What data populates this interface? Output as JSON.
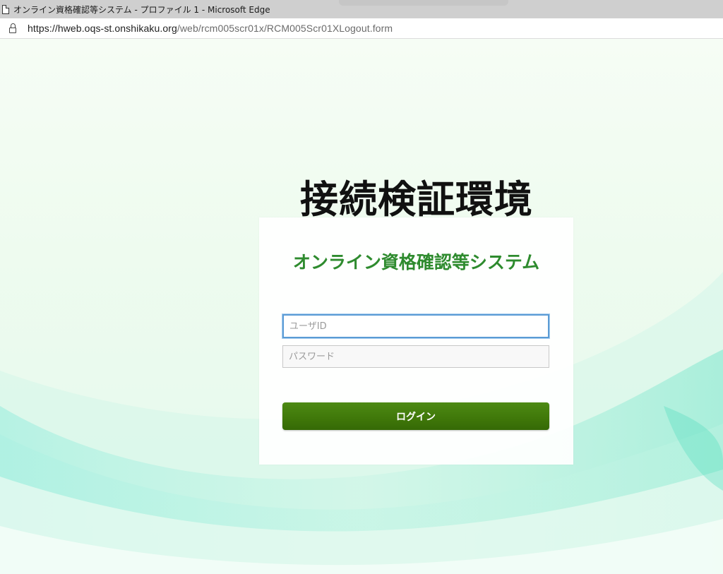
{
  "window": {
    "title": "オンライン資格確認等システム - プロファイル 1 - Microsoft Edge",
    "icon": "document-icon"
  },
  "addressbar": {
    "icon": "lock-icon",
    "url_host": "https://hweb.oqs-st.onshikaku.org",
    "url_path": "/web/rcm005scr01x/RCM005Scr01XLogout.form"
  },
  "page": {
    "env_title": "接続検証環境",
    "system_title": "オンライン資格確認等システム",
    "userid_placeholder": "ユーザID",
    "password_placeholder": "パスワード",
    "login_label": "ログイン"
  },
  "colors": {
    "system_title": "#2e8b2e",
    "login_button": "#3f7709",
    "focus_border": "#5b9bd5",
    "background_wave": "#7de8d6"
  }
}
